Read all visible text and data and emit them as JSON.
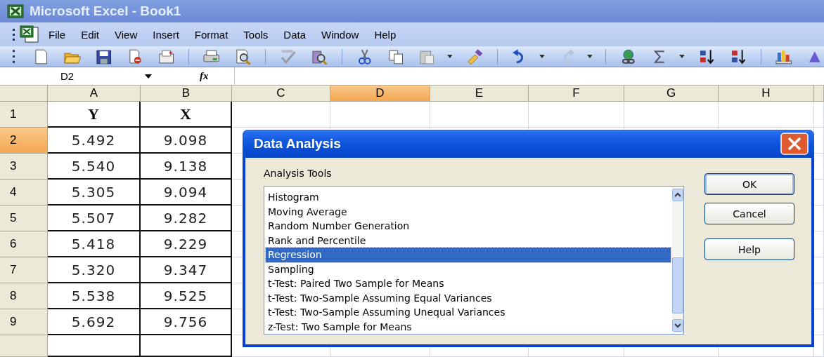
{
  "window": {
    "title": "Microsoft Excel - Book1"
  },
  "menu": [
    {
      "label": "File"
    },
    {
      "label": "Edit"
    },
    {
      "label": "View"
    },
    {
      "label": "Insert"
    },
    {
      "label": "Format"
    },
    {
      "label": "Tools"
    },
    {
      "label": "Data"
    },
    {
      "label": "Window"
    },
    {
      "label": "Help"
    }
  ],
  "name_box": {
    "value": "D2"
  },
  "formula_bar": {
    "label": "fx"
  },
  "columns": [
    {
      "label": "A",
      "selected": false
    },
    {
      "label": "B",
      "selected": false
    },
    {
      "label": "C",
      "selected": false
    },
    {
      "label": "D",
      "selected": true
    },
    {
      "label": "E",
      "selected": false
    },
    {
      "label": "F",
      "selected": false
    },
    {
      "label": "G",
      "selected": false
    },
    {
      "label": "H",
      "selected": false
    }
  ],
  "rows": [
    {
      "number": "1",
      "selected": false,
      "kind": "header",
      "cells": [
        "Y",
        "X"
      ]
    },
    {
      "number": "2",
      "selected": true,
      "kind": "data",
      "cells": [
        "5.492",
        "9.098"
      ]
    },
    {
      "number": "3",
      "selected": false,
      "kind": "data",
      "cells": [
        "5.540",
        "9.138"
      ]
    },
    {
      "number": "4",
      "selected": false,
      "kind": "data",
      "cells": [
        "5.305",
        "9.094"
      ]
    },
    {
      "number": "5",
      "selected": false,
      "kind": "data",
      "cells": [
        "5.507",
        "9.282"
      ]
    },
    {
      "number": "6",
      "selected": false,
      "kind": "data",
      "cells": [
        "5.418",
        "9.229"
      ]
    },
    {
      "number": "7",
      "selected": false,
      "kind": "data",
      "cells": [
        "5.320",
        "9.347"
      ]
    },
    {
      "number": "8",
      "selected": false,
      "kind": "data",
      "cells": [
        "5.538",
        "9.525"
      ]
    },
    {
      "number": "9",
      "selected": false,
      "kind": "data",
      "cells": [
        "5.692",
        "9.756"
      ]
    }
  ],
  "dialog": {
    "title": "Data Analysis",
    "list_label": "Analysis Tools",
    "items": [
      {
        "label": "Histogram",
        "selected": false
      },
      {
        "label": "Moving Average",
        "selected": false
      },
      {
        "label": "Random Number Generation",
        "selected": false
      },
      {
        "label": "Rank and Percentile",
        "selected": false
      },
      {
        "label": "Regression",
        "selected": true
      },
      {
        "label": "Sampling",
        "selected": false
      },
      {
        "label": "t-Test: Paired Two Sample for Means",
        "selected": false
      },
      {
        "label": "t-Test: Two-Sample Assuming Equal Variances",
        "selected": false
      },
      {
        "label": "t-Test: Two-Sample Assuming Unequal Variances",
        "selected": false
      },
      {
        "label": "z-Test: Two Sample for Means",
        "selected": false
      }
    ],
    "buttons": [
      {
        "label": "OK"
      },
      {
        "label": "Cancel"
      },
      {
        "label": "Help"
      }
    ]
  }
}
